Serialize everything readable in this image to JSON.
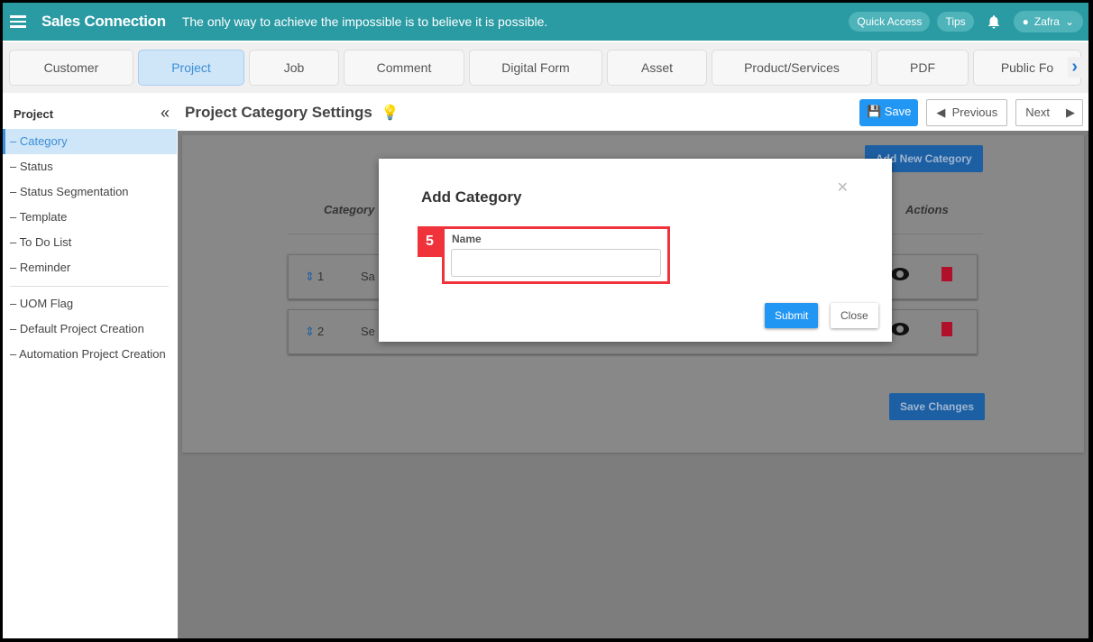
{
  "header": {
    "brand": "Sales Connection",
    "quote": "The only way to achieve the impossible is to believe it is possible.",
    "quick_access": "Quick Access",
    "tips": "Tips",
    "user": "Zafra"
  },
  "tabs": [
    {
      "label": "Customer",
      "w": 138
    },
    {
      "label": "Project",
      "w": 118
    },
    {
      "label": "Job",
      "w": 100
    },
    {
      "label": "Comment",
      "w": 134
    },
    {
      "label": "Digital Form",
      "w": 148
    },
    {
      "label": "Asset",
      "w": 111
    },
    {
      "label": "Product/Services",
      "w": 178
    },
    {
      "label": "PDF",
      "w": 102
    },
    {
      "label": "Public Fo",
      "w": 120
    }
  ],
  "sidebar": {
    "title": "Project",
    "items": [
      "– Category",
      "– Status",
      "– Status Segmentation",
      "– Template",
      "– To Do List",
      "– Reminder"
    ],
    "items2": [
      "– UOM Flag",
      "– Default Project Creation",
      "– Automation Project Creation"
    ]
  },
  "page": {
    "title": "Project Category Settings",
    "save": "Save",
    "previous": "Previous",
    "next": "Next"
  },
  "content": {
    "add_new": "Add New Category",
    "col_category": "Category",
    "col_actions": "Actions",
    "rows": [
      {
        "num": "1",
        "name": "Sa"
      },
      {
        "num": "2",
        "name": "Se"
      }
    ],
    "save_changes": "Save Changes"
  },
  "modal": {
    "title": "Add Category",
    "step": "5",
    "name_label": "Name",
    "name_value": "",
    "submit": "Submit",
    "close": "Close"
  },
  "colors": {
    "header": "#2a9aa3",
    "accent": "#2196f3",
    "highlight": "#f0323a",
    "delete": "#b0102a"
  }
}
